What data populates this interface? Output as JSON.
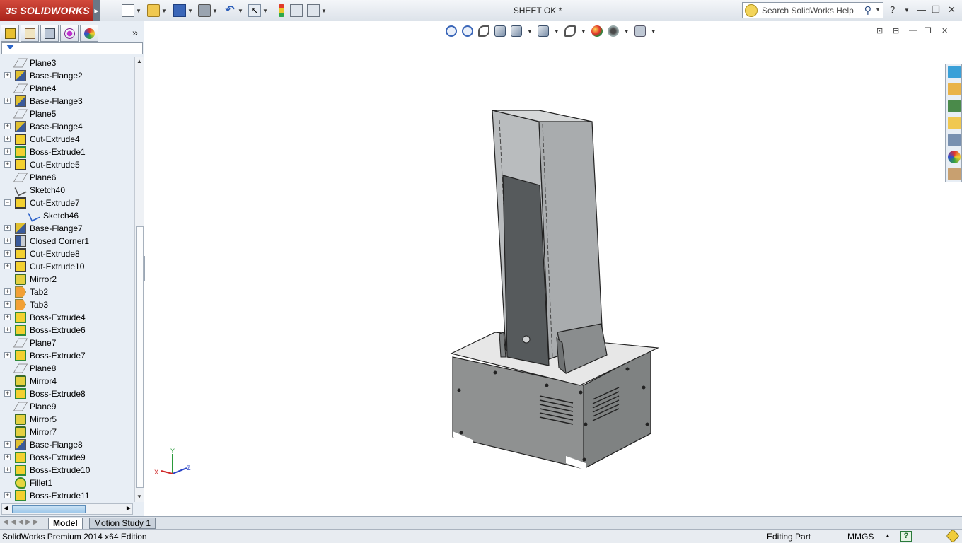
{
  "app": {
    "brand": "SOLIDWORKS",
    "brand_prefix": "3S",
    "document_title": "SHEET OK *",
    "search_placeholder": "Search SolidWorks Help",
    "accent_color": "#c0392b"
  },
  "toolbar_icons": [
    "new-document-icon",
    "open-icon",
    "save-icon",
    "print-icon",
    "undo-icon",
    "select-icon",
    "rebuild-icon",
    "file-properties-icon",
    "options-icon"
  ],
  "view_toolbar_icons": [
    "zoom-to-fit-icon",
    "zoom-to-area-icon",
    "previous-view-icon",
    "section-view-icon",
    "view-orientation-icon",
    "display-style-icon",
    "hide-show-items-icon",
    "edit-appearance-icon",
    "apply-scene-icon",
    "view-settings-icon"
  ],
  "feature_tree": {
    "items": [
      {
        "label": "Plane3",
        "icon": "plane",
        "expandable": false,
        "indent": 0
      },
      {
        "label": "Base-Flange2",
        "icon": "flange",
        "expandable": true,
        "indent": 0
      },
      {
        "label": "Plane4",
        "icon": "plane",
        "expandable": false,
        "indent": 0
      },
      {
        "label": "Base-Flange3",
        "icon": "flange",
        "expandable": true,
        "indent": 0
      },
      {
        "label": "Plane5",
        "icon": "plane",
        "expandable": false,
        "indent": 0
      },
      {
        "label": "Base-Flange4",
        "icon": "flange",
        "expandable": true,
        "indent": 0
      },
      {
        "label": "Cut-Extrude4",
        "icon": "cut",
        "expandable": true,
        "indent": 0
      },
      {
        "label": "Boss-Extrude1",
        "icon": "boss",
        "expandable": true,
        "indent": 0
      },
      {
        "label": "Cut-Extrude5",
        "icon": "cut",
        "expandable": true,
        "indent": 0
      },
      {
        "label": "Plane6",
        "icon": "plane",
        "expandable": false,
        "indent": 0
      },
      {
        "label": "Sketch40",
        "icon": "sketch",
        "expandable": false,
        "indent": 0
      },
      {
        "label": "Cut-Extrude7",
        "icon": "cut",
        "expandable": true,
        "expanded": true,
        "indent": 0
      },
      {
        "label": "Sketch46",
        "icon": "sketch-blue",
        "expandable": false,
        "indent": 1
      },
      {
        "label": "Base-Flange7",
        "icon": "flange",
        "expandable": true,
        "indent": 0
      },
      {
        "label": "Closed Corner1",
        "icon": "corner",
        "expandable": true,
        "indent": 0
      },
      {
        "label": "Cut-Extrude8",
        "icon": "cut",
        "expandable": true,
        "indent": 0
      },
      {
        "label": "Cut-Extrude10",
        "icon": "cut",
        "expandable": true,
        "indent": 0
      },
      {
        "label": "Mirror2",
        "icon": "mirror",
        "expandable": false,
        "indent": 0
      },
      {
        "label": "Tab2",
        "icon": "tab",
        "expandable": true,
        "indent": 0
      },
      {
        "label": "Tab3",
        "icon": "tab",
        "expandable": true,
        "indent": 0
      },
      {
        "label": "Boss-Extrude4",
        "icon": "boss",
        "expandable": true,
        "indent": 0
      },
      {
        "label": "Boss-Extrude6",
        "icon": "boss",
        "expandable": true,
        "indent": 0
      },
      {
        "label": "Plane7",
        "icon": "plane",
        "expandable": false,
        "indent": 0
      },
      {
        "label": "Boss-Extrude7",
        "icon": "boss",
        "expandable": true,
        "indent": 0
      },
      {
        "label": "Plane8",
        "icon": "plane",
        "expandable": false,
        "indent": 0
      },
      {
        "label": "Mirror4",
        "icon": "mirror",
        "expandable": false,
        "indent": 0
      },
      {
        "label": "Boss-Extrude8",
        "icon": "boss",
        "expandable": true,
        "indent": 0
      },
      {
        "label": "Plane9",
        "icon": "plane",
        "expandable": false,
        "indent": 0
      },
      {
        "label": "Mirror5",
        "icon": "mirror",
        "expandable": false,
        "indent": 0
      },
      {
        "label": "Mirror7",
        "icon": "mirror",
        "expandable": false,
        "indent": 0
      },
      {
        "label": "Base-Flange8",
        "icon": "flange",
        "expandable": true,
        "indent": 0
      },
      {
        "label": "Boss-Extrude9",
        "icon": "boss",
        "expandable": true,
        "indent": 0
      },
      {
        "label": "Boss-Extrude10",
        "icon": "boss",
        "expandable": true,
        "indent": 0
      },
      {
        "label": "Fillet1",
        "icon": "fillet",
        "expandable": false,
        "indent": 0
      },
      {
        "label": "Boss-Extrude11",
        "icon": "boss",
        "expandable": true,
        "indent": 0
      }
    ]
  },
  "bottom_tabs": [
    {
      "label": "Model",
      "active": true
    },
    {
      "label": "Motion Study 1",
      "active": false
    }
  ],
  "triad": {
    "y": "Y",
    "z": "Z",
    "x": "X"
  },
  "status_bar": {
    "product": "SolidWorks Premium 2014 x64 Edition",
    "mode": "Editing Part",
    "units": "MMGS",
    "help": "?"
  }
}
